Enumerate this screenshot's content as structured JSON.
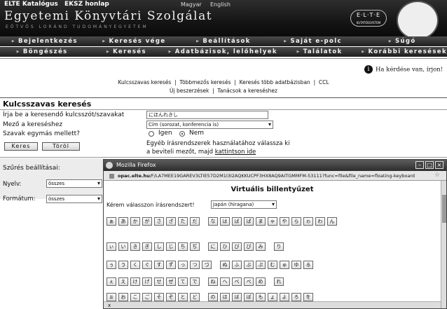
{
  "banner": {
    "catalog_link": "ELTE Katalógus",
    "ekszsite_link": "EKSZ honlap",
    "lang_hu": "Magyar",
    "lang_en": "English",
    "title": "Egyetemi Könyvtári Szolgálat",
    "subtitle": "EÖTVÖS LORÁND TUDOMÁNYEGYETEM",
    "elte_logo": "E·L·T·E",
    "elte_logo_sub": "KUTATÓEGYETEM"
  },
  "nav_top": [
    "Bejelentkezés",
    "Keresés vége",
    "Beállítások",
    "Saját e-polc",
    "Súgó"
  ],
  "nav_bottom": [
    "Böngészés",
    "Keresés",
    "Adatbázisok, lelőhelyek",
    "Találatok",
    "Korábbi keresések"
  ],
  "help": {
    "text": "Ha kérdése van, írjon!",
    "icon": "info-icon"
  },
  "links_row1": [
    "Kulcsszavas keresés",
    "Többmezős keresés",
    "Keresés több adatbázisban",
    "CCL"
  ],
  "links_row2": [
    "Új beszerzések",
    "Tanácsok a kereséshez"
  ],
  "form": {
    "heading": "Kulcsszavas keresés",
    "keyword_label": "Írja be a keresendő kulcsszót/szavakat",
    "keyword_value": "にほんれきし",
    "field_label": "Mező a kereséshez",
    "field_value": "Cím (sorozat, konferencia is)",
    "adjacent_label": "Szavak egymás mellett?",
    "yes": "Igen",
    "no": "Nem",
    "search_button": "Keres",
    "clear_button": "Töröl",
    "note_line1": "Egyéb írásrendszerek használatához válassza ki",
    "note_line2": "a beviteli mezőt, majd",
    "note_link": "kattintson ide"
  },
  "filters": {
    "heading": "Szűrés beállításai:",
    "language_label": "Nyelv:",
    "language_value": "összes",
    "format_label": "Formátum:",
    "format_value": "összes"
  },
  "popup": {
    "window_title": "Mozilla Firefox",
    "url_host": "opac.elte.hu",
    "url_path": "/F/LA7MEE19GAREV3LTIE57D2M1I3I2AQKKUCPF3HX8AQ9AITGMMFM-53111?func=file&file_name=floating-keyboard",
    "heading": "Virtuális billentyűzet",
    "choose_label": "Kérem válasszon írásrendszert!",
    "script_value": "Japán (hiragana)",
    "close_x": "x",
    "rows": [
      [
        "ぁ",
        "あ",
        "か",
        "が",
        "さ",
        "ざ",
        "た",
        "だ",
        "|",
        "な",
        "は",
        "ば",
        "ぱ",
        "ま",
        "ゃ",
        "や",
        "ら",
        "ゎ",
        "わ",
        "ん"
      ],
      [
        "ぃ",
        "い",
        "き",
        "ぎ",
        "し",
        "じ",
        "ち",
        "ぢ",
        "|",
        "に",
        "ひ",
        "び",
        "ぴ",
        "み",
        "|",
        "り"
      ],
      [
        "ぅ",
        "う",
        "く",
        "ぐ",
        "す",
        "ず",
        "っ",
        "つ",
        "づ",
        "|",
        "ぬ",
        "ふ",
        "ぶ",
        "ぷ",
        "む",
        "ゅ",
        "ゆ",
        "る"
      ],
      [
        "ぇ",
        "え",
        "け",
        "げ",
        "せ",
        "ぜ",
        "て",
        "で",
        "|",
        "ね",
        "へ",
        "べ",
        "ぺ",
        "め",
        "|",
        "れ"
      ],
      [
        "ぉ",
        "お",
        "こ",
        "ご",
        "そ",
        "ぞ",
        "と",
        "ど",
        "|",
        "の",
        "ほ",
        "ぼ",
        "ぽ",
        "も",
        "ょ",
        "よ",
        "ろ",
        "を"
      ]
    ]
  }
}
